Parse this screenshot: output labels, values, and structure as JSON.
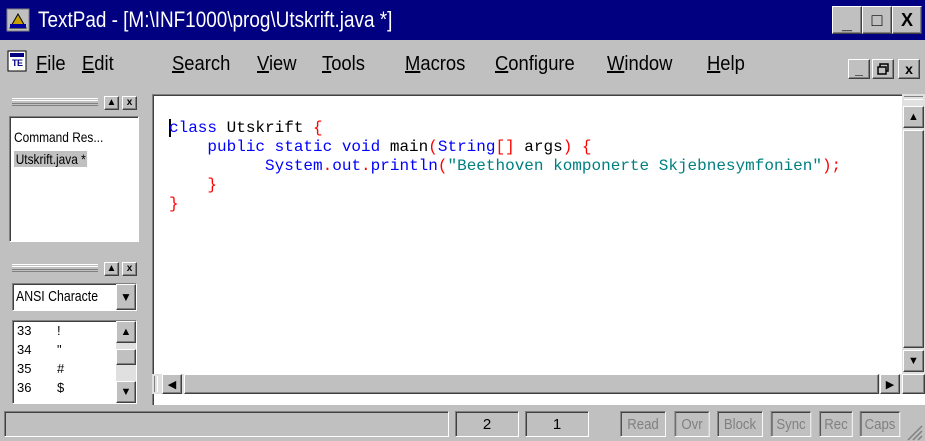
{
  "window": {
    "title": "TextPad - [M:\\INF1000\\prog\\Utskrift.java *]",
    "minimize_label": "_",
    "maximize_label": "□",
    "close_label": "X"
  },
  "menu": {
    "items": [
      {
        "label": "File",
        "mnemonic": "F",
        "rest": "ile"
      },
      {
        "label": "Edit",
        "mnemonic": "E",
        "rest": "dit"
      },
      {
        "label": "Search",
        "mnemonic": "S",
        "rest": "earch"
      },
      {
        "label": "View",
        "mnemonic": "V",
        "rest": "iew"
      },
      {
        "label": "Tools",
        "mnemonic": "T",
        "rest": "ools"
      },
      {
        "label": "Macros",
        "mnemonic": "M",
        "rest": "acros"
      },
      {
        "label": "Configure",
        "mnemonic": "C",
        "rest": "onfigure"
      },
      {
        "label": "Window",
        "mnemonic": "W",
        "rest": "indow"
      },
      {
        "label": "Help",
        "mnemonic": "H",
        "rest": "elp"
      }
    ],
    "mdi_minimize": "_",
    "mdi_restore": "🗗",
    "mdi_close": "x"
  },
  "document_selector": {
    "items": [
      "Command Res...",
      "Utskrift.java *"
    ],
    "selected_index": 1
  },
  "clip_library": {
    "selected": "ANSI Characte",
    "rows": [
      {
        "code": "33",
        "char": "!"
      },
      {
        "code": "34",
        "char": "\""
      },
      {
        "code": "35",
        "char": "#"
      },
      {
        "code": "36",
        "char": "$"
      }
    ]
  },
  "editor": {
    "lines": [
      {
        "indent": "",
        "parts": [
          {
            "t": "class",
            "c": "kw"
          },
          {
            "t": " Utskrift ",
            "c": ""
          },
          {
            "t": "{",
            "c": "sym"
          }
        ]
      },
      {
        "indent": "    ",
        "parts": [
          {
            "t": "public static void",
            "c": "kw"
          },
          {
            "t": " main",
            "c": ""
          },
          {
            "t": "(",
            "c": "sym"
          },
          {
            "t": "String",
            "c": "kw"
          },
          {
            "t": "[]",
            "c": "sym"
          },
          {
            "t": " args",
            "c": ""
          },
          {
            "t": ")",
            "c": "sym"
          },
          {
            "t": " ",
            "c": ""
          },
          {
            "t": "{",
            "c": "sym"
          }
        ]
      },
      {
        "indent": "          ",
        "parts": [
          {
            "t": "System",
            "c": "kw"
          },
          {
            "t": ".",
            "c": "sym"
          },
          {
            "t": "out",
            "c": "kw"
          },
          {
            "t": ".",
            "c": "sym"
          },
          {
            "t": "println",
            "c": "kw"
          },
          {
            "t": "(",
            "c": "sym"
          },
          {
            "t": "\"Beethoven komponerte Skjebnesymfonien\"",
            "c": "str"
          },
          {
            "t": ");",
            "c": "sym"
          }
        ]
      },
      {
        "indent": "    ",
        "parts": [
          {
            "t": "}",
            "c": "sym"
          }
        ]
      },
      {
        "indent": "",
        "parts": [
          {
            "t": "}",
            "c": "sym"
          }
        ]
      }
    ]
  },
  "status": {
    "line": "2",
    "column": "1",
    "flags": [
      "Read",
      "Ovr",
      "Block",
      "Sync",
      "Rec",
      "Caps"
    ]
  },
  "colors": {
    "title_bar": "#000080",
    "keyword": "#0000ff",
    "symbol": "#ff0000",
    "string": "#008080"
  }
}
